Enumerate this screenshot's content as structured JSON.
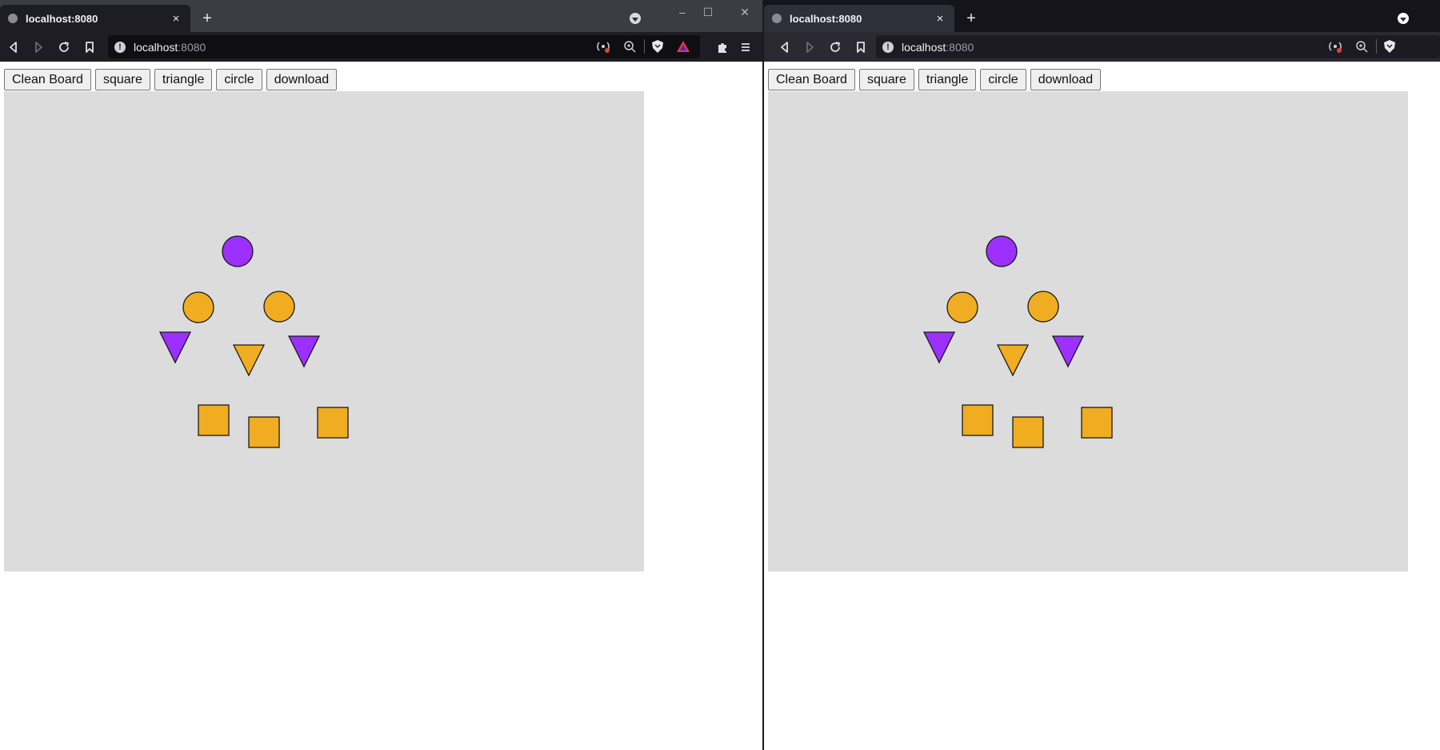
{
  "browser": {
    "tab_title": "localhost:8080",
    "url_host": "localhost",
    "url_port": ":8080",
    "tab_close_glyph": "×",
    "new_tab_glyph": "+",
    "minimize_glyph": "–",
    "maximize_glyph": "☐",
    "close_glyph": "✕"
  },
  "toolbar": {
    "clean_label": "Clean Board",
    "square_label": "square",
    "triangle_label": "triangle",
    "circle_label": "circle",
    "download_label": "download"
  },
  "colors": {
    "purple": "#9b30ff",
    "orange": "#f0ad22",
    "board": "#dcdcdc",
    "stroke": "#1a1a1a"
  },
  "shapes": [
    {
      "kind": "circle",
      "color": "purple"
    },
    {
      "kind": "circle",
      "color": "orange"
    },
    {
      "kind": "circle",
      "color": "orange"
    },
    {
      "kind": "triangle",
      "color": "purple"
    },
    {
      "kind": "triangle",
      "color": "orange"
    },
    {
      "kind": "triangle",
      "color": "purple"
    },
    {
      "kind": "square",
      "color": "orange"
    },
    {
      "kind": "square",
      "color": "orange"
    },
    {
      "kind": "square",
      "color": "orange"
    }
  ],
  "icons": {
    "back": "back-icon",
    "forward": "forward-icon",
    "reload": "reload-icon",
    "bookmark": "bookmark-icon",
    "site_info": "info-icon",
    "extensions": "puzzle-icon",
    "menu": "hamburger-icon",
    "brave": "brave-shield-icon",
    "rewards": "brave-rewards-icon",
    "zoom": "zoom-icon",
    "broadcast": "broadcast-icon"
  }
}
